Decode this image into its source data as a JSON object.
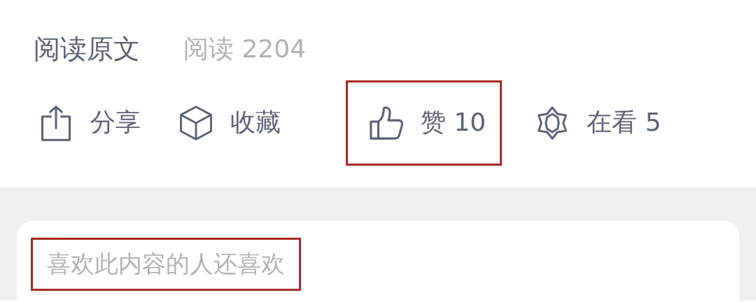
{
  "footer": {
    "read_original": "阅读原文",
    "read_count": "阅读 2204"
  },
  "actions": [
    {
      "kind": "share",
      "label": "分享",
      "highlighted": false
    },
    {
      "kind": "favorite",
      "label": "收藏",
      "highlighted": false
    },
    {
      "kind": "like",
      "label": "赞 10",
      "highlighted": true
    },
    {
      "kind": "watching",
      "label": "在看 5",
      "highlighted": false
    }
  ],
  "recommend": {
    "title": "喜欢此内容的人还喜欢",
    "highlighted": true
  }
}
